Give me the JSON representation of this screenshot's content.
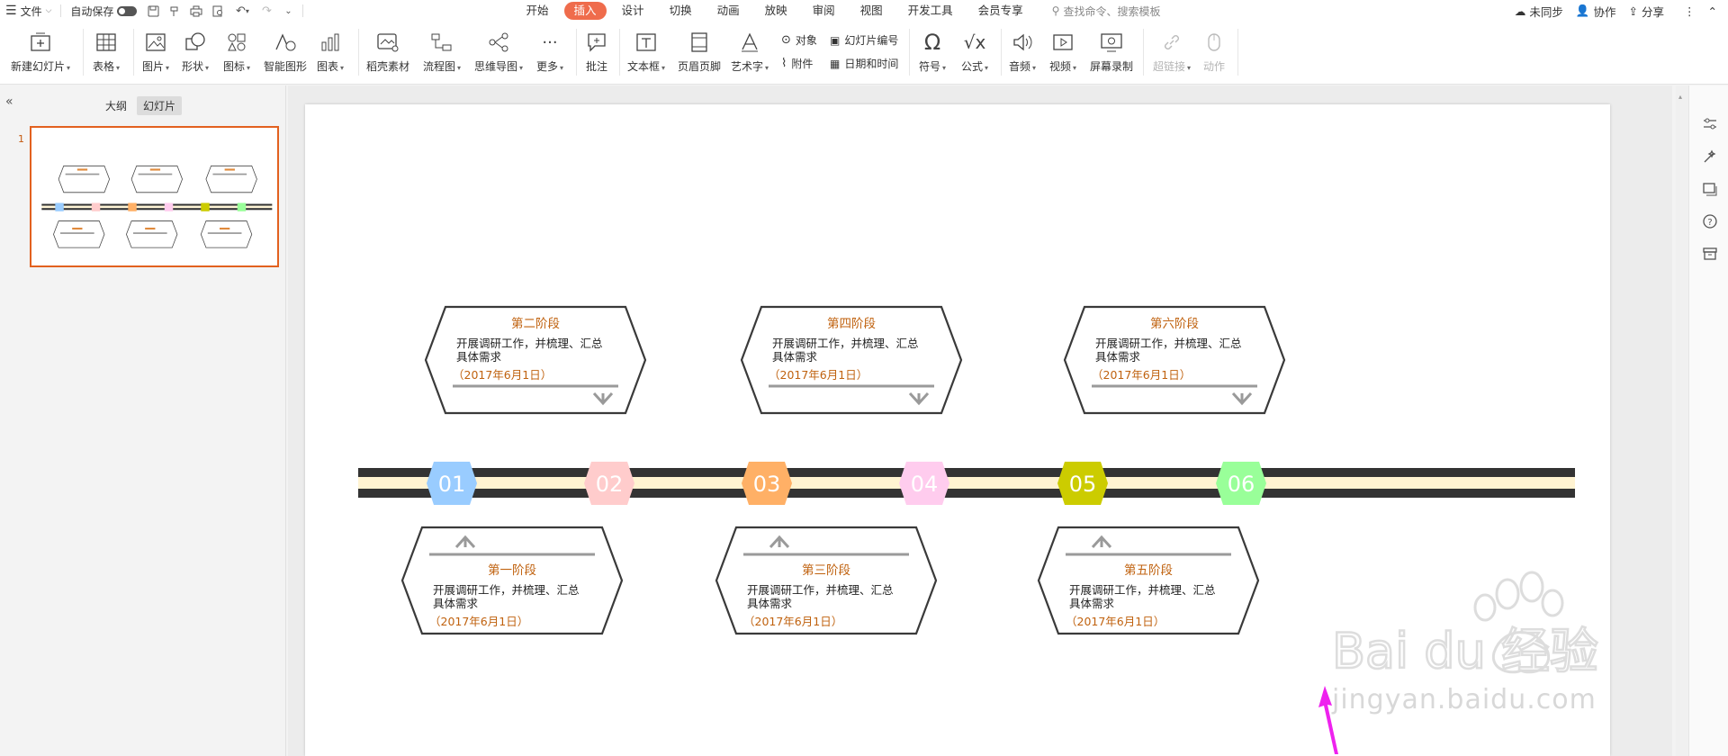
{
  "menubar": {
    "file_label": "文件",
    "autosave_label": "自动保存",
    "tabs": [
      "开始",
      "插入",
      "设计",
      "切换",
      "动画",
      "放映",
      "审阅",
      "视图",
      "开发工具",
      "会员专享"
    ],
    "active_tab": "插入",
    "search_placeholder": "查找命令、搜索模板",
    "sync_label": "未同步",
    "collab_label": "协作",
    "share_label": "分享"
  },
  "ribbon": {
    "new_slide": "新建幻灯片",
    "table": "表格",
    "picture": "图片",
    "shape": "形状",
    "icon": "图标",
    "smart_art": "智能图形",
    "chart": "图表",
    "material": "稻壳素材",
    "flowchart": "流程图",
    "mindmap": "思维导图",
    "more": "更多",
    "comment": "批注",
    "textbox": "文本框",
    "header_footer": "页眉页脚",
    "art_text": "艺术字",
    "object": "对象",
    "attachment": "附件",
    "slide_number": "幻灯片编号",
    "date_time": "日期和时间",
    "symbol": "符号",
    "formula": "公式",
    "audio": "音频",
    "video": "视频",
    "screen_record": "屏幕录制",
    "hyperlink": "超链接",
    "action": "动作"
  },
  "left_panel": {
    "outline_tab": "大纲",
    "slides_tab": "幻灯片",
    "slide_index": "1"
  },
  "slide": {
    "stages_top": [
      {
        "title": "第二阶段",
        "body": "开展调研工作，并梳理、汇总具体需求",
        "date": "（2017年6月1日）"
      },
      {
        "title": "第四阶段",
        "body": "开展调研工作，并梳理、汇总具体需求",
        "date": "（2017年6月1日）"
      },
      {
        "title": "第六阶段",
        "body": "开展调研工作，并梳理、汇总具体需求",
        "date": "（2017年6月1日）"
      }
    ],
    "stages_bottom": [
      {
        "title": "第一阶段",
        "body": "开展调研工作，并梳理、汇总具体需求",
        "date": "（2017年6月1日）"
      },
      {
        "title": "第三阶段",
        "body": "开展调研工作，并梳理、汇总具体需求",
        "date": "（2017年6月1日）"
      },
      {
        "title": "第五阶段",
        "body": "开展调研工作，并梳理、汇总具体需求",
        "date": "（2017年6月1日）"
      }
    ],
    "markers": [
      {
        "num": "01",
        "color": "#99ccff"
      },
      {
        "num": "02",
        "color": "#ffcccc"
      },
      {
        "num": "03",
        "color": "#ffb066"
      },
      {
        "num": "04",
        "color": "#ffccee"
      },
      {
        "num": "05",
        "color": "#cccc00"
      },
      {
        "num": "06",
        "color": "#99ff99"
      }
    ]
  },
  "watermark": {
    "brand": "Bai du 经验",
    "url": "jingyan.baidu.com"
  }
}
